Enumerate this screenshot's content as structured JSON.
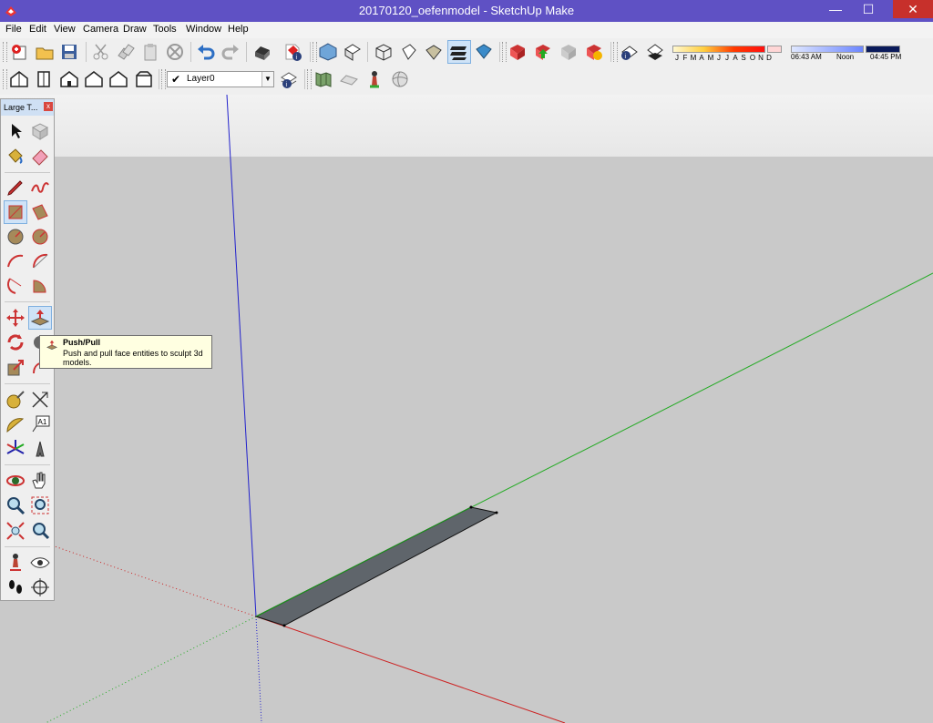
{
  "window": {
    "title": "20170120_oefenmodel - SketchUp Make",
    "minimize": "—",
    "maximize": "☐",
    "close": "✕"
  },
  "menu": [
    "File",
    "Edit",
    "View",
    "Camera",
    "Draw",
    "Tools",
    "Window",
    "Help"
  ],
  "layer": {
    "current": "Layer0",
    "check": "✔",
    "arrow": "▼"
  },
  "shadow": {
    "months": [
      "J",
      "F",
      "M",
      "A",
      "M",
      "J",
      "J",
      "A",
      "S",
      "O",
      "N",
      "D"
    ],
    "time_start": "06:43 AM",
    "time_mid": "Noon",
    "time_end": "04:45 PM"
  },
  "palette": {
    "title": "Large T...",
    "close": "x"
  },
  "tooltip": {
    "title": "Push/Pull",
    "description": "Push and pull face entities to sculpt 3d models."
  },
  "colors": {
    "titlebar": "#5f51c4",
    "close": "#c7302b",
    "axis_red": "#cc2222",
    "axis_green": "#22aa22",
    "axis_blue": "#2222cc",
    "face": "#5f656b"
  }
}
